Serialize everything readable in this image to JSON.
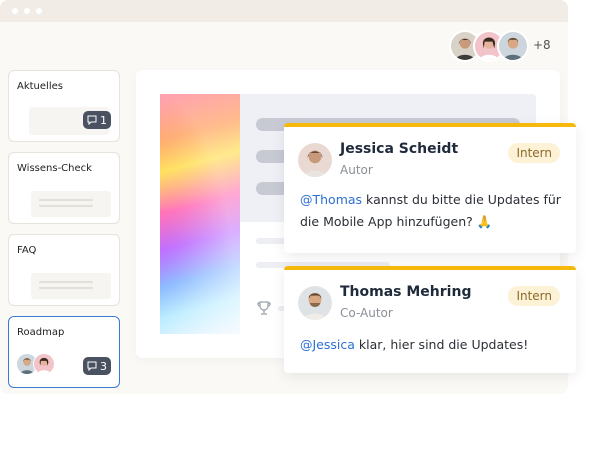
{
  "colors": {
    "accent": "#f6b80b",
    "mention": "#2d6fd6",
    "active_border": "#3b7bd8",
    "badge": "#4a5261",
    "tag_bg": "#fdf1d6"
  },
  "collaborators": {
    "more_count": "+8"
  },
  "sidebar": {
    "items": [
      {
        "label": "Aktuelles",
        "comment_count": "1"
      },
      {
        "label": "Wissens-Check"
      },
      {
        "label": "FAQ"
      },
      {
        "label": "Roadmap",
        "comment_count": "3",
        "active": true
      }
    ]
  },
  "comments": [
    {
      "author": "Jessica Scheidt",
      "role": "Autor",
      "tag": "Intern",
      "mention": "@Thomas",
      "text_line1": "kannst du bitte die Updates für",
      "text_line2": "die Mobile App hinzufügen? 🙏"
    },
    {
      "author": "Thomas Mehring",
      "role": "Co-Autor",
      "tag": "Intern",
      "mention": "@Jessica",
      "text": "klar, hier sind die Updates!"
    }
  ],
  "icons": [
    "comment-icon",
    "trophy-icon",
    "avatar-icon"
  ]
}
